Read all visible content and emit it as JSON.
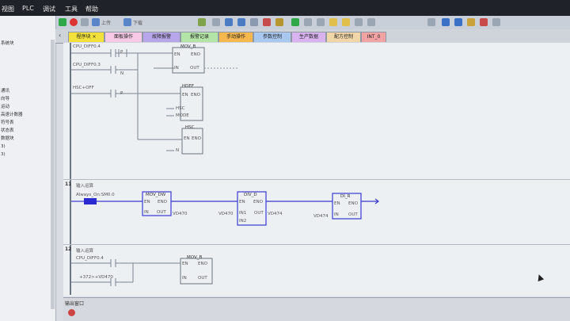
{
  "menu": {
    "items": [
      "视图",
      "PLC",
      "调试",
      "工具",
      "帮助"
    ]
  },
  "toolbar": {
    "upload": "上传",
    "download": "下载"
  },
  "left_panel": {
    "lines": [
      "系统块",
      "通讯",
      "向导",
      "运动",
      "高速计数器",
      "符号表",
      "状态表",
      "数据块",
      "3)",
      "3)"
    ]
  },
  "tabs": [
    {
      "label": "程序块",
      "color": "#f2e13a"
    },
    {
      "label": "面板操作",
      "color": "#f6c9e6"
    },
    {
      "label": "故障报警",
      "color": "#b7a6ea"
    },
    {
      "label": "报警记录",
      "color": "#b3e6a6"
    },
    {
      "label": "手动操作",
      "color": "#f5b84f"
    },
    {
      "label": "参数控制",
      "color": "#a9c8f0"
    },
    {
      "label": "生产数据",
      "color": "#d8b3f0"
    },
    {
      "label": "配方控制",
      "color": "#f1d7a8"
    },
    {
      "label": "INT_0",
      "color": "#f2a3a3"
    }
  ],
  "tab_close": "×",
  "network1": {
    "contact1": "CPU_DIFF0.4",
    "contact2": "CPU_DIFF0.3",
    "contact3": "HSC+OFF",
    "p_label": "P",
    "n_label": "N",
    "box1": {
      "title": "MOV_B",
      "en": "EN",
      "eno": "ENO",
      "in": "IN",
      "out": "OUT"
    },
    "box2": {
      "title": "HDEF",
      "en": "EN",
      "eno": "ENO",
      "hsc": "HSC",
      "mode": "MODE"
    },
    "box3": {
      "title": "HSC",
      "en": "EN",
      "eno": "ENO",
      "n": "N"
    }
  },
  "network2": {
    "num": "11",
    "comment": "输入运算",
    "contact": "Always_On:SM0.0",
    "box1": {
      "title": "MOV_DW",
      "en": "EN",
      "eno": "ENO",
      "in": "IN",
      "out": "OUT"
    },
    "box2": {
      "title": "DIV_D",
      "en": "EN",
      "eno": "ENO",
      "in1": "IN1",
      "out": "OUT",
      "in2": "IN2"
    },
    "box3": {
      "title": "DI_R",
      "en": "EN",
      "eno": "ENO",
      "in": "IN",
      "out": "OUT"
    },
    "box1_out": "VD470",
    "box2_in": "VD470",
    "box2_out": "VD474",
    "box3_in": "VD474"
  },
  "network3": {
    "num": "12",
    "comment": "输入运算",
    "contact1": "CPU_DIFF0.4",
    "contact2": "+372>+VD470",
    "box": {
      "title": "MOV_B",
      "en": "EN",
      "eno": "ENO",
      "in": "IN",
      "out": "OUT"
    }
  },
  "output_window": {
    "title": "输出窗口"
  }
}
